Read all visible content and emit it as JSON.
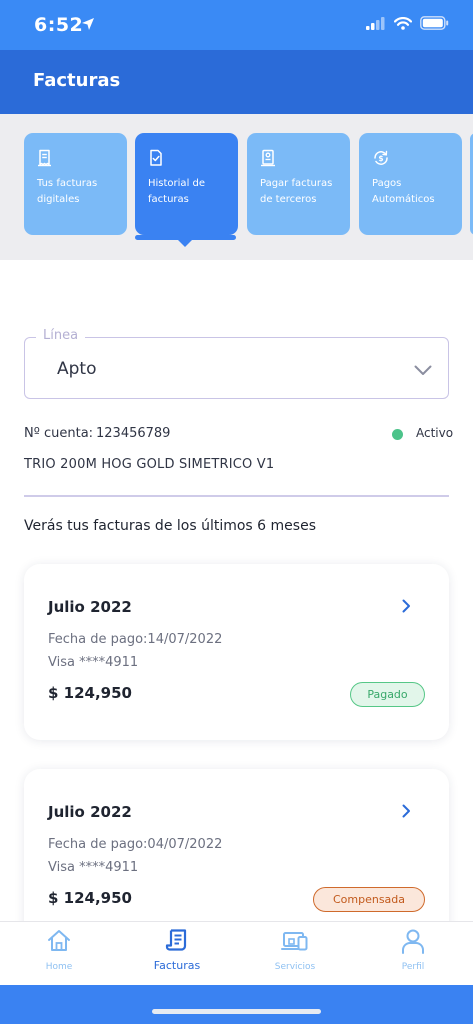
{
  "status_bar": {
    "time": "6:52"
  },
  "header": {
    "title": "Facturas"
  },
  "tabs": [
    {
      "label": "Tus facturas digitales",
      "icon": "receipt-icon"
    },
    {
      "label": "Historial de facturas",
      "icon": "invoice-check-icon",
      "active": true
    },
    {
      "label": "Pagar facturas de terceros",
      "icon": "bill-icon"
    },
    {
      "label": "Pagos Automáticos",
      "icon": "auto-pay-icon"
    }
  ],
  "line_select": {
    "legend": "Línea",
    "value": "Apto"
  },
  "account": {
    "label": "Nº cuenta:",
    "number": "123456789",
    "status": "Activo",
    "plan": "TRIO 200M HOG GOLD SIMETRICO V1"
  },
  "months_note": "Verás tus facturas de los últimos 6 meses",
  "invoices": [
    {
      "month": "Julio 2022",
      "date": "Fecha de pago:14/07/2022",
      "card": "Visa ****4911",
      "amount": "$ 124,950",
      "status": "Pagado"
    },
    {
      "month": "Julio 2022",
      "date": "Fecha de pago:04/07/2022",
      "card": "Visa ****4911",
      "amount": "$ 124,950",
      "status": "Compensada"
    }
  ],
  "bottom_nav": [
    {
      "label": "Home"
    },
    {
      "label": "Facturas",
      "active": true
    },
    {
      "label": "Servicios"
    },
    {
      "label": "Perfil"
    }
  ],
  "colors": {
    "primary": "#2b6bd8",
    "tab_active": "#3a82f2",
    "tab_inactive": "#7bbaf7",
    "paid": "#38a86a",
    "compensated": "#c25a1d",
    "active_dot": "#4cc38a"
  }
}
